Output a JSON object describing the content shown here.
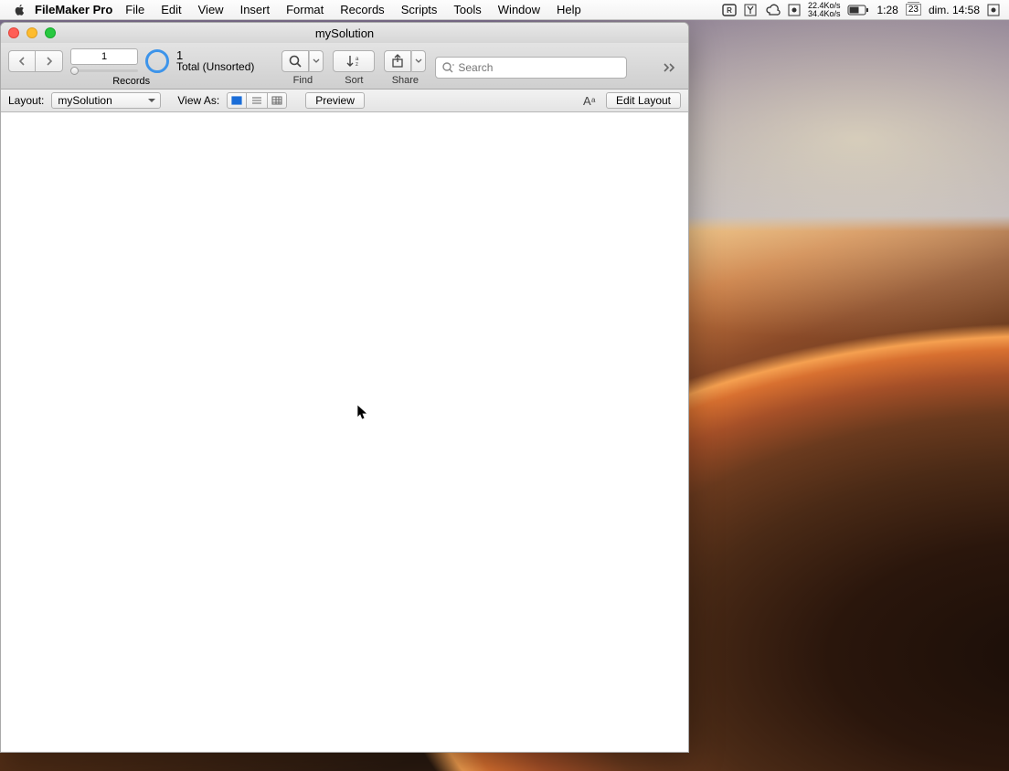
{
  "menubar": {
    "app": "FileMaker Pro",
    "menus": [
      "File",
      "Edit",
      "View",
      "Insert",
      "Format",
      "Records",
      "Scripts",
      "Tools",
      "Window",
      "Help"
    ],
    "net_up": "22.4Ko/s",
    "net_down": "34.4Ko/s",
    "batt_time": "1:28",
    "cal_day": "23",
    "date": "dim. 14:58"
  },
  "window": {
    "title": "mySolution"
  },
  "toolbar": {
    "record_num": "1",
    "record_total": "1",
    "record_status": "Total (Unsorted)",
    "records_label": "Records",
    "find_label": "Find",
    "sort_label": "Sort",
    "share_label": "Share",
    "search_placeholder": "Search"
  },
  "formatbar": {
    "layout_label": "Layout:",
    "layout_value": "mySolution",
    "viewas_label": "View As:",
    "preview_label": "Preview",
    "editlayout_label": "Edit Layout"
  }
}
